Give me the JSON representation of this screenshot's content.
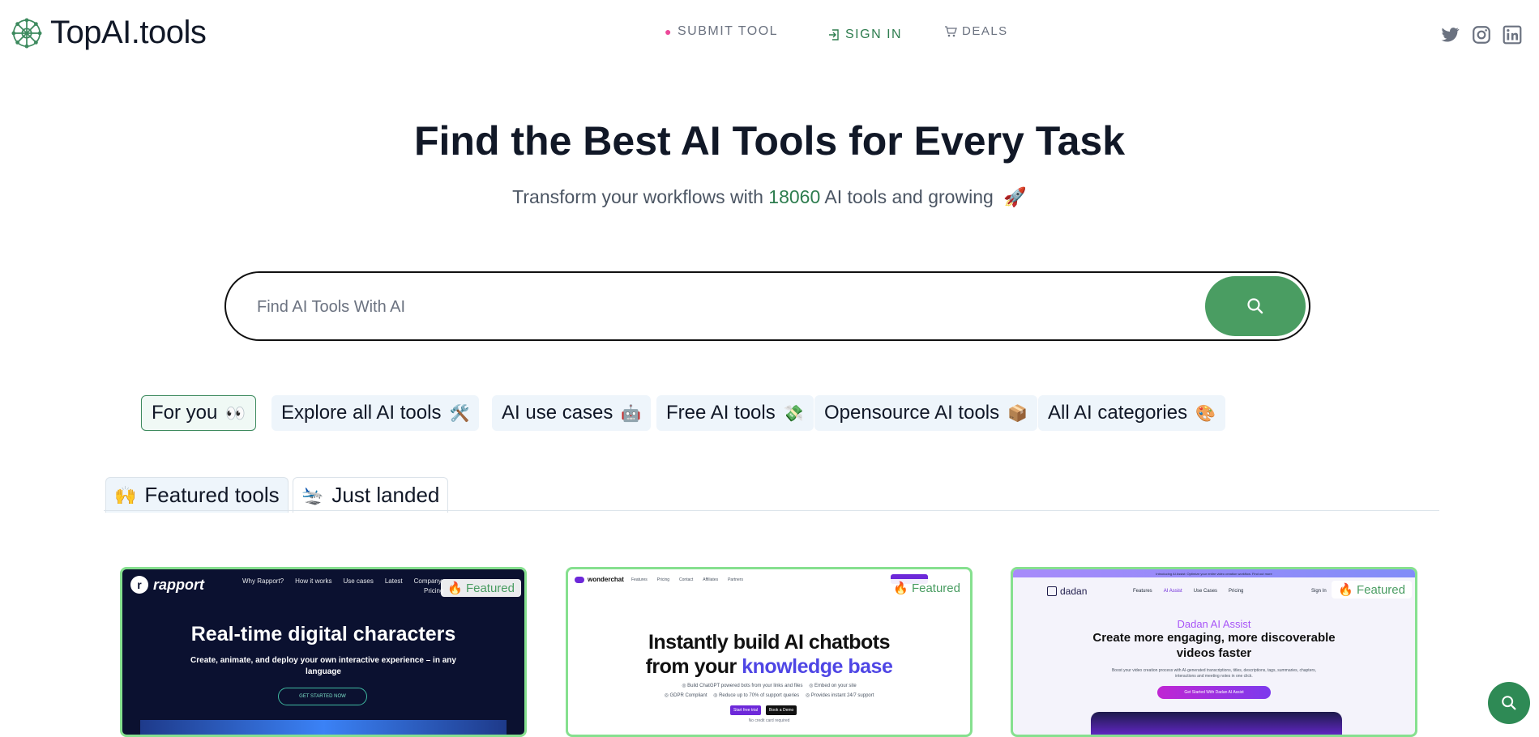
{
  "header": {
    "logo_text": "TopAI.tools",
    "nav": [
      {
        "label": "SUBMIT TOOL",
        "icon": "pin-icon",
        "color": "#6b7280"
      },
      {
        "label": "SIGN IN",
        "icon": "sign-in-icon",
        "color": "#2e7d4f"
      },
      {
        "label": "DEALS",
        "icon": "cart-icon",
        "color": "#6b7280"
      }
    ],
    "social": [
      "twitter-icon",
      "instagram-icon",
      "linkedin-icon"
    ]
  },
  "hero": {
    "title": "Find the Best AI Tools for Every Task",
    "subtitle_pre": "Transform your workflows with",
    "count": "18060",
    "subtitle_post": "AI tools and growing",
    "emoji": "🚀"
  },
  "search": {
    "placeholder": "Find AI Tools With AI"
  },
  "chips": [
    {
      "label": "For you",
      "emoji": "👀",
      "active": true
    },
    {
      "label": "Explore all AI tools",
      "emoji": "🛠️",
      "active": false
    },
    {
      "label": "AI use cases",
      "emoji": "🤖",
      "active": false
    },
    {
      "label": "Free AI tools",
      "emoji": "💸",
      "active": false
    },
    {
      "label": "Opensource AI tools",
      "emoji": "📦",
      "active": false
    },
    {
      "label": "All AI categories",
      "emoji": "🎨",
      "active": false
    }
  ],
  "tabs": [
    {
      "label": "Featured tools",
      "emoji": "🙌",
      "active": true
    },
    {
      "label": "Just landed",
      "emoji": "🛬",
      "active": false
    }
  ],
  "cards": [
    {
      "badge": "Featured",
      "brand": "rapport",
      "menu": [
        "Why Rapport?",
        "How it works",
        "Use cases",
        "Latest",
        "Company",
        "Pricing"
      ],
      "headline": "Real-time digital characters",
      "sub": "Create, animate, and deploy your own interactive experience – in any language",
      "cta": "GET STARTED NOW"
    },
    {
      "badge": "Featured",
      "brand": "wonderchat",
      "menu": [
        "Features",
        "Pricing",
        "Contact",
        "Affiliates",
        "Partners"
      ],
      "headline_1": "Instantly build AI chatbots",
      "headline_2_pre": "from your",
      "headline_2_accent": "knowledge base",
      "bullets": [
        "Build ChatGPT powered bots from your links and files",
        "Embed on your site",
        "GDPR Compliant",
        "Reduce up to 70% of support queries",
        "Provides instant 24/7 support"
      ],
      "cta_primary": "Start free trial",
      "cta_secondary": "Book a Demo",
      "note": "No credit card required"
    },
    {
      "badge": "Featured",
      "brand": "dadan",
      "announce": "Introducing AI Assist: Optimize your entire video creation workflow. Find out more",
      "menu": [
        "Features",
        "AI Assist",
        "Use Cases",
        "Pricing",
        "Sign In"
      ],
      "kicker": "Dadan AI Assist",
      "headline": "Create more engaging, more discoverable videos faster",
      "sub": "Boost your video creation process with AI-generated transcriptions, titles, descriptions, tags, summaries, chapters, interactions and meeting notes in one click.",
      "cta": "Get Started With Dadan AI Assist"
    }
  ],
  "colors": {
    "brand_green": "#4a9d62",
    "card_border": "#86e08f",
    "chip_bg": "#eef5fb"
  }
}
